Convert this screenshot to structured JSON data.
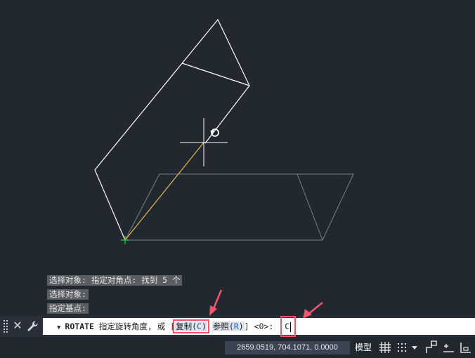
{
  "history": {
    "line1": "选择对象: 指定对角点: 找到 5 个",
    "line2": "选择对象:",
    "line3": "指定基点:"
  },
  "command": {
    "name": "ROTATE",
    "prompt": "指定旋转角度, 或 [",
    "option_copy_label": "复制(",
    "option_copy_key": "C",
    "option_close": ")",
    "option_ref_label": "参照(",
    "option_ref_key": "R",
    "bracket_close": "]",
    "default_value": "<0>:",
    "typed_value": "C"
  },
  "status": {
    "coordinates": "2659.0519, 704.1071, 0.0000",
    "space_label": "模型"
  },
  "icons": {
    "close": "close-icon",
    "customize": "wrench-icon",
    "grid": "grid-icon",
    "snap": "snap-mode-icon",
    "dropdown": "chevron-down-icon",
    "ortho": "ortho-icon",
    "infer": "infer-constraints-icon",
    "dynamic_input": "dynamic-input-icon"
  },
  "colors": {
    "canvas_bg": "#212830",
    "selected_geometry": "#ffffff",
    "ghost_geometry": "#7a7f86",
    "rubber_band": "#e8b84a",
    "base_point": "#2ecc40",
    "annotation_arrow": "#f2566b"
  }
}
